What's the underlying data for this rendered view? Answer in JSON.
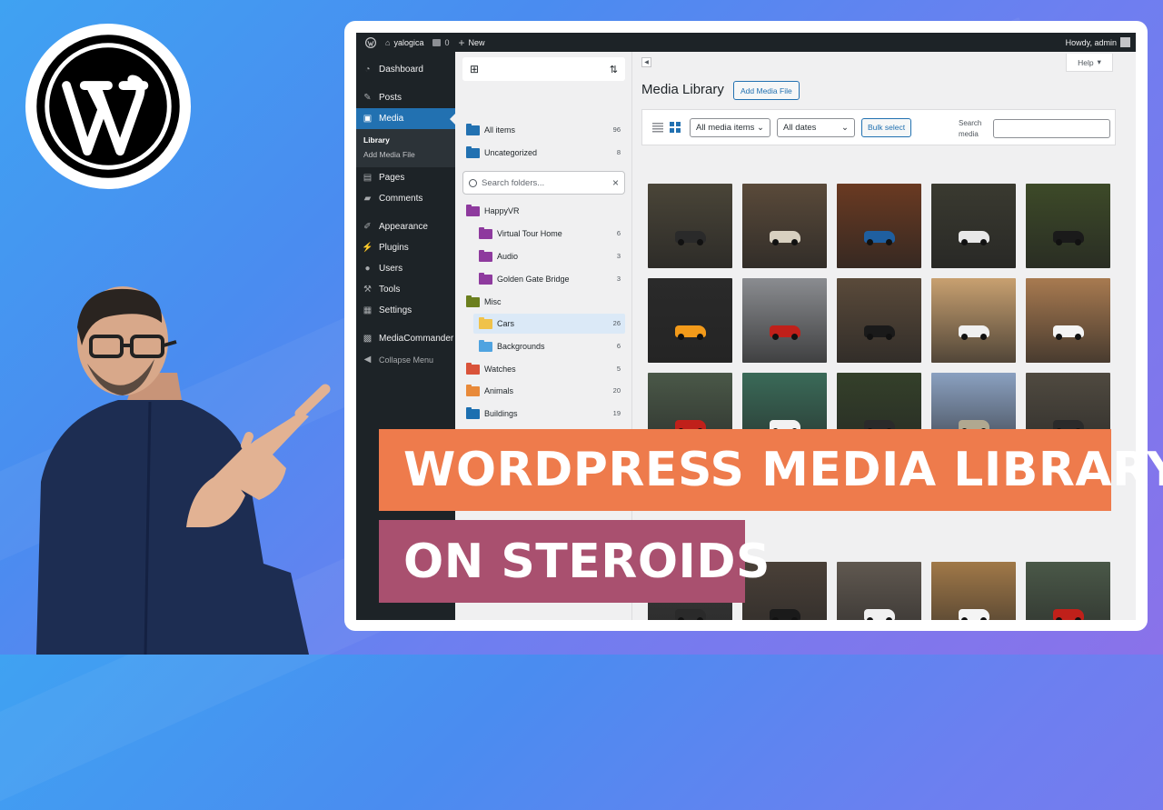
{
  "adminbar": {
    "site_name": "yalogica",
    "comments": "0",
    "new_label": "New",
    "howdy": "Howdy, admin"
  },
  "sidebar": {
    "items": [
      {
        "label": "Dashboard",
        "icon": "dashboard-icon"
      },
      {
        "label": "Posts",
        "icon": "pin-icon"
      },
      {
        "label": "Media",
        "icon": "media-icon",
        "active": true
      },
      {
        "label": "Pages",
        "icon": "page-icon"
      },
      {
        "label": "Comments",
        "icon": "comment-icon"
      },
      {
        "label": "Appearance",
        "icon": "brush-icon"
      },
      {
        "label": "Plugins",
        "icon": "plug-icon"
      },
      {
        "label": "Users",
        "icon": "user-icon"
      },
      {
        "label": "Tools",
        "icon": "wrench-icon"
      },
      {
        "label": "Settings",
        "icon": "settings-icon"
      },
      {
        "label": "MediaCommander",
        "icon": "grid-icon"
      },
      {
        "label": "Collapse Menu",
        "icon": "collapse-icon"
      }
    ],
    "submenu": [
      "Library",
      "Add Media File"
    ]
  },
  "folders": {
    "top": [
      {
        "label": "All items",
        "count": "96",
        "color": "#2271b1"
      },
      {
        "label": "Uncategorized",
        "count": "8",
        "color": "#2271b1"
      }
    ],
    "search_placeholder": "Search folders...",
    "tree": [
      {
        "label": "HappyVR",
        "count": "",
        "color": "#8e3a9e",
        "level": 0
      },
      {
        "label": "Virtual Tour Home",
        "count": "6",
        "color": "#8e3a9e",
        "level": 1
      },
      {
        "label": "Audio",
        "count": "3",
        "color": "#8e3a9e",
        "level": 1
      },
      {
        "label": "Golden Gate Bridge",
        "count": "3",
        "color": "#8e3a9e",
        "level": 1
      },
      {
        "label": "Misc",
        "count": "",
        "color": "#6b7f1e",
        "level": 0
      },
      {
        "label": "Cars",
        "count": "26",
        "color": "#f0c24a",
        "level": 1
      },
      {
        "label": "Backgrounds",
        "count": "6",
        "color": "#4fa3e0",
        "level": 1
      },
      {
        "label": "Watches",
        "count": "5",
        "color": "#d9533a",
        "level": 0
      },
      {
        "label": "Animals",
        "count": "20",
        "color": "#e88a3a",
        "level": 0
      },
      {
        "label": "Buildings",
        "count": "19",
        "color": "#1c6fb0",
        "level": 0
      }
    ]
  },
  "main": {
    "title": "Media Library",
    "add_button": "Add Media File",
    "help": "Help",
    "filter_type": "All media items",
    "filter_date": "All dates",
    "bulk": "Bulk select",
    "search_label": "Search media"
  },
  "thumbnails": [
    {
      "bg": "#4a4538",
      "car": "#2a2a2a"
    },
    {
      "bg": "#5a4a3a",
      "car": "#d8d0c0"
    },
    {
      "bg": "#6a3a22",
      "car": "#1f5fa0"
    },
    {
      "bg": "#3a3a30",
      "car": "#e8e8e8"
    },
    {
      "bg": "#3d4a28",
      "car": "#1a1a1a"
    },
    {
      "bg": "#2a2a2a",
      "car": "#f29a1a"
    },
    {
      "bg": "#8a8c90",
      "car": "#c0201a"
    },
    {
      "bg": "#5a4a3a",
      "car": "#1a1a1a"
    },
    {
      "bg": "#c8a070",
      "car": "#f0f0f0"
    },
    {
      "bg": "#a87a50",
      "car": "#f4f4f4"
    },
    {
      "bg": "#4a5848",
      "car": "#c0201a"
    },
    {
      "bg": "#3a6a58",
      "car": "#f2f2f2"
    },
    {
      "bg": "#34402a",
      "car": "#2a2a2a"
    },
    {
      "bg": "#8aa0c0",
      "car": "#b0a890"
    },
    {
      "bg": "#504a40",
      "car": "#2a2a2a"
    },
    {
      "bg": "#3a3a3a",
      "car": "#2a2a2a"
    },
    {
      "bg": "#4a4038",
      "car": "#1a1a1a"
    },
    {
      "bg": "#605850",
      "car": "#f0f0f0"
    },
    {
      "bg": "#a07848",
      "car": "#f4f4f4"
    },
    {
      "bg": "#4a5848",
      "car": "#c0201a"
    }
  ],
  "banner": {
    "line1": "WORDPRESS MEDIA LIBRARY",
    "line2": "ON STEROIDS"
  }
}
